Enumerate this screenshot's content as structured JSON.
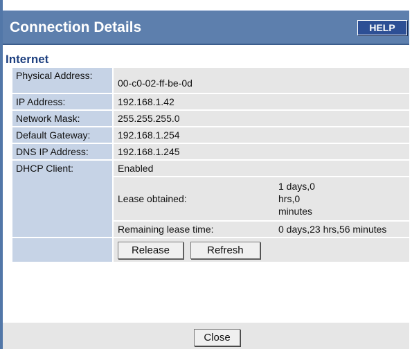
{
  "title": "Connection Details",
  "help_label": "HELP",
  "section": "Internet",
  "rows": {
    "physical_address": {
      "label": "Physical Address:",
      "value": "00-c0-02-ff-be-0d"
    },
    "ip_address": {
      "label": "IP Address:",
      "value": "192.168.1.42"
    },
    "network_mask": {
      "label": "Network Mask:",
      "value": "255.255.255.0"
    },
    "default_gateway": {
      "label": "Default Gateway:",
      "value": "192.168.1.254"
    },
    "dns_ip_address": {
      "label": "DNS IP Address:",
      "value": "192.168.1.245"
    },
    "dhcp_client": {
      "label": "DHCP Client:",
      "value": "Enabled"
    }
  },
  "lease": {
    "obtained_label": "Lease obtained:",
    "obtained_line1": "1 days,0",
    "obtained_line2": "hrs,0",
    "obtained_line3": "minutes",
    "remaining_label": "Remaining lease time:",
    "remaining_value": "0 days,23 hrs,56 minutes"
  },
  "buttons": {
    "release": "Release",
    "refresh": "Refresh",
    "close": "Close"
  }
}
